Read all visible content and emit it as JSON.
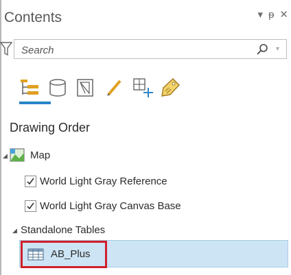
{
  "pane": {
    "title": "Contents",
    "controls": {
      "menu": "▾",
      "pin": "ᵽ",
      "close": "✕"
    }
  },
  "search": {
    "placeholder": "Search",
    "value": ""
  },
  "toolbar": {
    "tools": [
      {
        "name": "list-by-drawing-order",
        "icon": "drawing-order-icon",
        "active": true
      },
      {
        "name": "list-by-source",
        "icon": "database-icon"
      },
      {
        "name": "list-by-selection",
        "icon": "selection-icon"
      },
      {
        "name": "list-by-editing",
        "icon": "pencil-icon"
      },
      {
        "name": "list-by-snapping",
        "icon": "snapping-icon"
      },
      {
        "name": "list-by-labeling",
        "icon": "label-tag-icon"
      }
    ],
    "active_color": "#2a85c8"
  },
  "tree": {
    "section_title": "Drawing Order",
    "map": {
      "label": "Map"
    },
    "layers": [
      {
        "label": "World Light Gray Reference",
        "checked": true
      },
      {
        "label": "World Light Gray Canvas Base",
        "checked": true
      }
    ],
    "standalone_tables": {
      "label": "Standalone Tables",
      "items": [
        {
          "label": "AB_Plus",
          "selected": true
        }
      ]
    }
  },
  "colors": {
    "selection_fill": "#cde4f4",
    "highlight_border": "#d0202a"
  }
}
